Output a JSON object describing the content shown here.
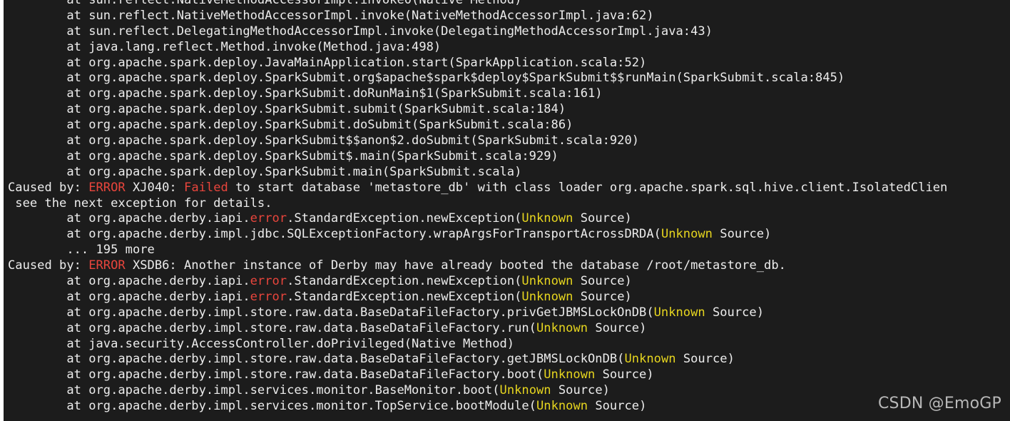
{
  "colors": {
    "background": "#1c1c1c",
    "text": "#ececec",
    "error_red": "#e8453c",
    "unknown_yellow": "#e6d51f",
    "watermark": "#b8b8b8"
  },
  "terminal": {
    "lines": [
      [
        {
          "t": "        at sun.reflect.NativeMethodAccessorImpl.invoke0(Native Method)",
          "c": "plain"
        }
      ],
      [
        {
          "t": "        at sun.reflect.NativeMethodAccessorImpl.invoke(NativeMethodAccessorImpl.java:62)",
          "c": "plain"
        }
      ],
      [
        {
          "t": "        at sun.reflect.DelegatingMethodAccessorImpl.invoke(DelegatingMethodAccessorImpl.java:43)",
          "c": "plain"
        }
      ],
      [
        {
          "t": "        at java.lang.reflect.Method.invoke(Method.java:498)",
          "c": "plain"
        }
      ],
      [
        {
          "t": "        at org.apache.spark.deploy.JavaMainApplication.start(SparkApplication.scala:52)",
          "c": "plain"
        }
      ],
      [
        {
          "t": "        at org.apache.spark.deploy.SparkSubmit.org$apache$spark$deploy$SparkSubmit$$runMain(SparkSubmit.scala:845)",
          "c": "plain"
        }
      ],
      [
        {
          "t": "        at org.apache.spark.deploy.SparkSubmit.doRunMain$1(SparkSubmit.scala:161)",
          "c": "plain"
        }
      ],
      [
        {
          "t": "        at org.apache.spark.deploy.SparkSubmit.submit(SparkSubmit.scala:184)",
          "c": "plain"
        }
      ],
      [
        {
          "t": "        at org.apache.spark.deploy.SparkSubmit.doSubmit(SparkSubmit.scala:86)",
          "c": "plain"
        }
      ],
      [
        {
          "t": "        at org.apache.spark.deploy.SparkSubmit$$anon$2.doSubmit(SparkSubmit.scala:920)",
          "c": "plain"
        }
      ],
      [
        {
          "t": "        at org.apache.spark.deploy.SparkSubmit$.main(SparkSubmit.scala:929)",
          "c": "plain"
        }
      ],
      [
        {
          "t": "        at org.apache.spark.deploy.SparkSubmit.main(SparkSubmit.scala)",
          "c": "plain"
        }
      ],
      [
        {
          "t": "Caused by: ",
          "c": "plain"
        },
        {
          "t": "ERROR",
          "c": "red"
        },
        {
          "t": " XJ040: ",
          "c": "plain"
        },
        {
          "t": "Failed",
          "c": "red"
        },
        {
          "t": " to start database 'metastore_db' with class loader org.apache.spark.sql.hive.client.IsolatedClien",
          "c": "plain"
        }
      ],
      [
        {
          "t": " see the next exception for details.",
          "c": "plain"
        }
      ],
      [
        {
          "t": "        at org.apache.derby.iapi.",
          "c": "plain"
        },
        {
          "t": "error",
          "c": "red"
        },
        {
          "t": ".StandardException.newException(",
          "c": "plain"
        },
        {
          "t": "Unknown",
          "c": "yellow"
        },
        {
          "t": " Source)",
          "c": "plain"
        }
      ],
      [
        {
          "t": "        at org.apache.derby.impl.jdbc.SQLExceptionFactory.wrapArgsForTransportAcrossDRDA(",
          "c": "plain"
        },
        {
          "t": "Unknown",
          "c": "yellow"
        },
        {
          "t": " Source)",
          "c": "plain"
        }
      ],
      [
        {
          "t": "        ... 195 more",
          "c": "plain"
        }
      ],
      [
        {
          "t": "Caused by: ",
          "c": "plain"
        },
        {
          "t": "ERROR",
          "c": "red"
        },
        {
          "t": " XSDB6: Another instance of Derby may have already booted the database /root/metastore_db.",
          "c": "plain"
        }
      ],
      [
        {
          "t": "        at org.apache.derby.iapi.",
          "c": "plain"
        },
        {
          "t": "error",
          "c": "red"
        },
        {
          "t": ".StandardException.newException(",
          "c": "plain"
        },
        {
          "t": "Unknown",
          "c": "yellow"
        },
        {
          "t": " Source)",
          "c": "plain"
        }
      ],
      [
        {
          "t": "        at org.apache.derby.iapi.",
          "c": "plain"
        },
        {
          "t": "error",
          "c": "red"
        },
        {
          "t": ".StandardException.newException(",
          "c": "plain"
        },
        {
          "t": "Unknown",
          "c": "yellow"
        },
        {
          "t": " Source)",
          "c": "plain"
        }
      ],
      [
        {
          "t": "        at org.apache.derby.impl.store.raw.data.BaseDataFileFactory.privGetJBMSLockOnDB(",
          "c": "plain"
        },
        {
          "t": "Unknown",
          "c": "yellow"
        },
        {
          "t": " Source)",
          "c": "plain"
        }
      ],
      [
        {
          "t": "        at org.apache.derby.impl.store.raw.data.BaseDataFileFactory.run(",
          "c": "plain"
        },
        {
          "t": "Unknown",
          "c": "yellow"
        },
        {
          "t": " Source)",
          "c": "plain"
        }
      ],
      [
        {
          "t": "        at java.security.AccessController.doPrivileged(Native Method)",
          "c": "plain"
        }
      ],
      [
        {
          "t": "        at org.apache.derby.impl.store.raw.data.BaseDataFileFactory.getJBMSLockOnDB(",
          "c": "plain"
        },
        {
          "t": "Unknown",
          "c": "yellow"
        },
        {
          "t": " Source)",
          "c": "plain"
        }
      ],
      [
        {
          "t": "        at org.apache.derby.impl.store.raw.data.BaseDataFileFactory.boot(",
          "c": "plain"
        },
        {
          "t": "Unknown",
          "c": "yellow"
        },
        {
          "t": " Source)",
          "c": "plain"
        }
      ],
      [
        {
          "t": "        at org.apache.derby.impl.services.monitor.BaseMonitor.boot(",
          "c": "plain"
        },
        {
          "t": "Unknown",
          "c": "yellow"
        },
        {
          "t": " Source)",
          "c": "plain"
        }
      ],
      [
        {
          "t": "        at org.apache.derby.impl.services.monitor.TopService.bootModule(",
          "c": "plain"
        },
        {
          "t": "Unknown",
          "c": "yellow"
        },
        {
          "t": " Source)",
          "c": "plain"
        }
      ]
    ]
  },
  "watermark": {
    "text": "CSDN @EmoGP"
  }
}
